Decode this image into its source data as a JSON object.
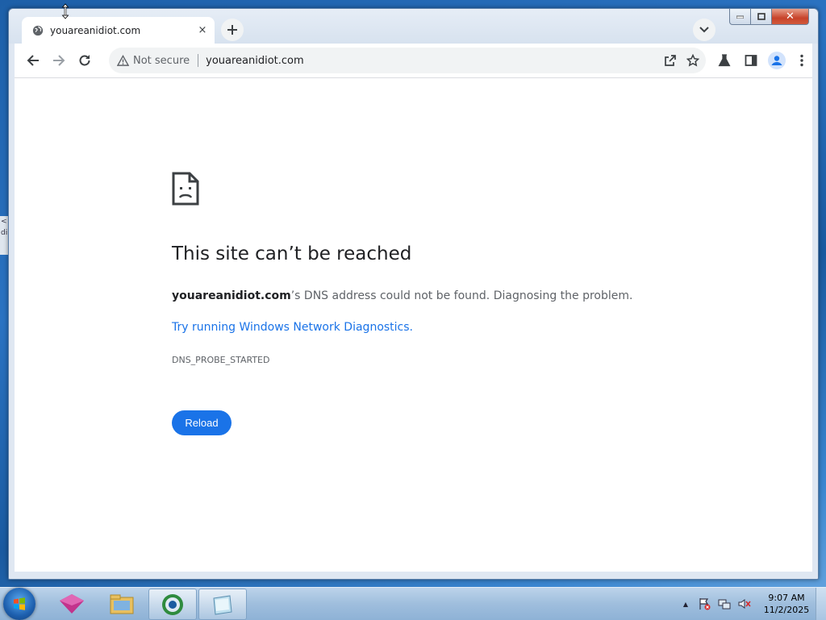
{
  "desktop": {
    "fragment_lines": [
      "<",
      "di"
    ]
  },
  "browser": {
    "tab": {
      "title": "youareanidiot.com",
      "close_glyph": "×"
    },
    "new_tab_glyph": "+",
    "window_controls": {
      "close_glyph": "✕"
    },
    "omnibox": {
      "security_label": "Not secure",
      "url": "youareanidiot.com"
    }
  },
  "error_page": {
    "heading": "This site can’t be reached",
    "message_domain": "youareanidiot.com",
    "message_rest": "’s DNS address could not be found. Diagnosing the problem.",
    "diagnostics_link": "Try running Windows Network Diagnostics.",
    "error_code": "DNS_PROBE_STARTED",
    "reload_label": "Reload"
  },
  "taskbar": {
    "clock_time": "9:07 AM",
    "clock_date": "11/2/2025",
    "tray_arrow": "▲"
  },
  "colors": {
    "link": "#1a73e8",
    "button": "#1a73e8",
    "text": "#202124",
    "muted": "#5f6368"
  }
}
